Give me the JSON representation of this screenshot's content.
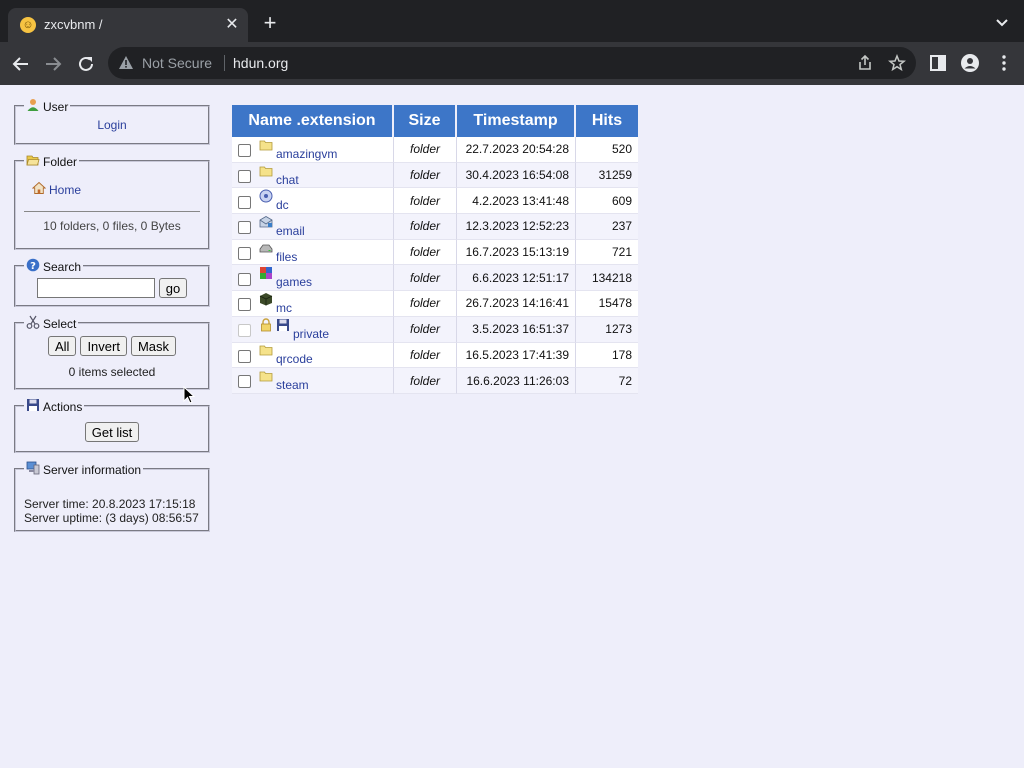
{
  "browser": {
    "tab_title": "zxcvbnm /",
    "not_secure": "Not Secure",
    "url": "hdun.org"
  },
  "sidebar": {
    "user": {
      "legend": "User",
      "login": "Login"
    },
    "folder": {
      "legend": "Folder",
      "home": "Home",
      "summary": "10 folders, 0 files, 0 Bytes"
    },
    "search": {
      "legend": "Search",
      "value": "",
      "go": "go"
    },
    "select": {
      "legend": "Select",
      "all": "All",
      "invert": "Invert",
      "mask": "Mask",
      "status": "0 items selected"
    },
    "actions": {
      "legend": "Actions",
      "get_list": "Get list"
    },
    "server": {
      "legend": "Server information",
      "time": "Server time: 20.8.2023 17:15:18",
      "uptime": "Server uptime: (3 days) 08:56:57"
    }
  },
  "table": {
    "headers": {
      "name": "Name .extension",
      "size": "Size",
      "timestamp": "Timestamp",
      "hits": "Hits"
    },
    "rows": [
      {
        "name": "amazingvm",
        "size": "folder",
        "timestamp": "22.7.2023 20:54:28",
        "hits": "520",
        "icon": "folder-icon"
      },
      {
        "name": "chat",
        "size": "folder",
        "timestamp": "30.4.2023 16:54:08",
        "hits": "31259",
        "icon": "folder-icon"
      },
      {
        "name": "dc",
        "size": "folder",
        "timestamp": "4.2.2023 13:41:48",
        "hits": "609",
        "icon": "disc-icon"
      },
      {
        "name": "email",
        "size": "folder",
        "timestamp": "12.3.2023 12:52:23",
        "hits": "237",
        "icon": "email-icon"
      },
      {
        "name": "files",
        "size": "folder",
        "timestamp": "16.7.2023 15:13:19",
        "hits": "721",
        "icon": "drive-icon"
      },
      {
        "name": "games",
        "size": "folder",
        "timestamp": "6.6.2023 12:51:17",
        "hits": "134218",
        "icon": "games-icon"
      },
      {
        "name": "mc",
        "size": "folder",
        "timestamp": "26.7.2023 14:16:41",
        "hits": "15478",
        "icon": "cube-icon"
      },
      {
        "name": "private",
        "size": "folder",
        "timestamp": "3.5.2023 16:51:37",
        "hits": "1273",
        "icon": "floppy-icon"
      },
      {
        "name": "qrcode",
        "size": "folder",
        "timestamp": "16.5.2023 17:41:39",
        "hits": "178",
        "icon": "folder-icon"
      },
      {
        "name": "steam",
        "size": "folder",
        "timestamp": "16.6.2023 11:26:03",
        "hits": "72",
        "icon": "folder-icon"
      }
    ]
  },
  "colors": {
    "header_bg": "#3d76c8",
    "page_bg": "#eeeefa",
    "link": "#2a3f9c"
  }
}
